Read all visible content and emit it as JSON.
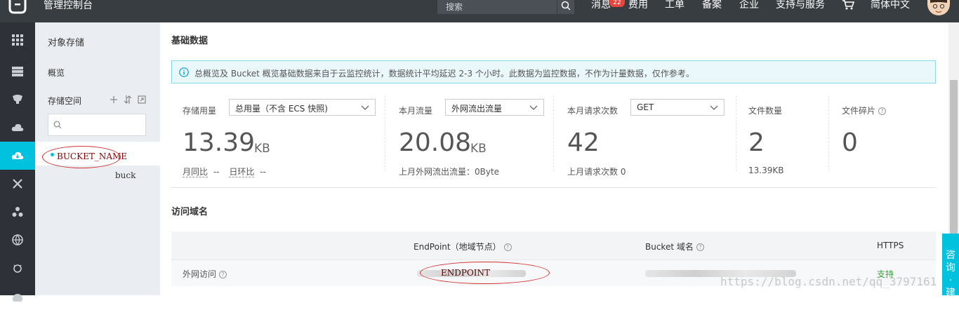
{
  "topbar": {
    "console_title": "管理控制台",
    "search_placeholder": "搜索",
    "message_badge": "22",
    "nav": [
      "消息",
      "费用",
      "工单",
      "备案",
      "企业",
      "支持与服务",
      "简体中文"
    ]
  },
  "sidebar": {
    "title": "对象存储",
    "overview": "概览",
    "buckets_label": "存储空间",
    "bucket_name": "BUCKET_NAME",
    "bucket_sub": "buck"
  },
  "main": {
    "basic_title": "基础数据",
    "info_text": "总概览及 Bucket 概览基础数据来自于云监控统计，数据统计平均延迟 2-3 个小时。此数据为监控数据，不作为计量数据，仅作参考。",
    "stats": {
      "storage": {
        "label": "存储用量",
        "select": "总用量（不含 ECS 快照)",
        "value": "13.39",
        "unit": "KB",
        "foot_mom": "月同比",
        "foot_mom_val": "--",
        "foot_dod": "日环比",
        "foot_dod_val": "--"
      },
      "traffic": {
        "label": "本月流量",
        "select": "外网流出流量",
        "value": "20.08",
        "unit": "KB",
        "foot": "上月外网流出流量：0Byte"
      },
      "requests": {
        "label": "本月请求次数",
        "select": "GET",
        "value": "42",
        "foot": "上月请求次数 0"
      },
      "files": {
        "label": "文件数量",
        "value": "2",
        "foot": "13.39KB"
      },
      "fragments": {
        "label": "文件碎片",
        "value": "0"
      }
    },
    "domain_title": "访问域名",
    "table": {
      "headers": [
        "EndPoint（地域节点）",
        "Bucket 域名",
        "HTTPS"
      ],
      "row": {
        "type": "外网访问",
        "endpoint": "ENDPOINT",
        "https": "支持"
      }
    }
  },
  "consult_label": "咨询·建",
  "watermark": "https://blog.csdn.net/qq_3797161",
  "colors": {
    "accent": "#00c1de",
    "topbar": "#373d41",
    "rail": "#2e3238",
    "sidebar": "#eaedf1",
    "annotation": "#d43030"
  }
}
